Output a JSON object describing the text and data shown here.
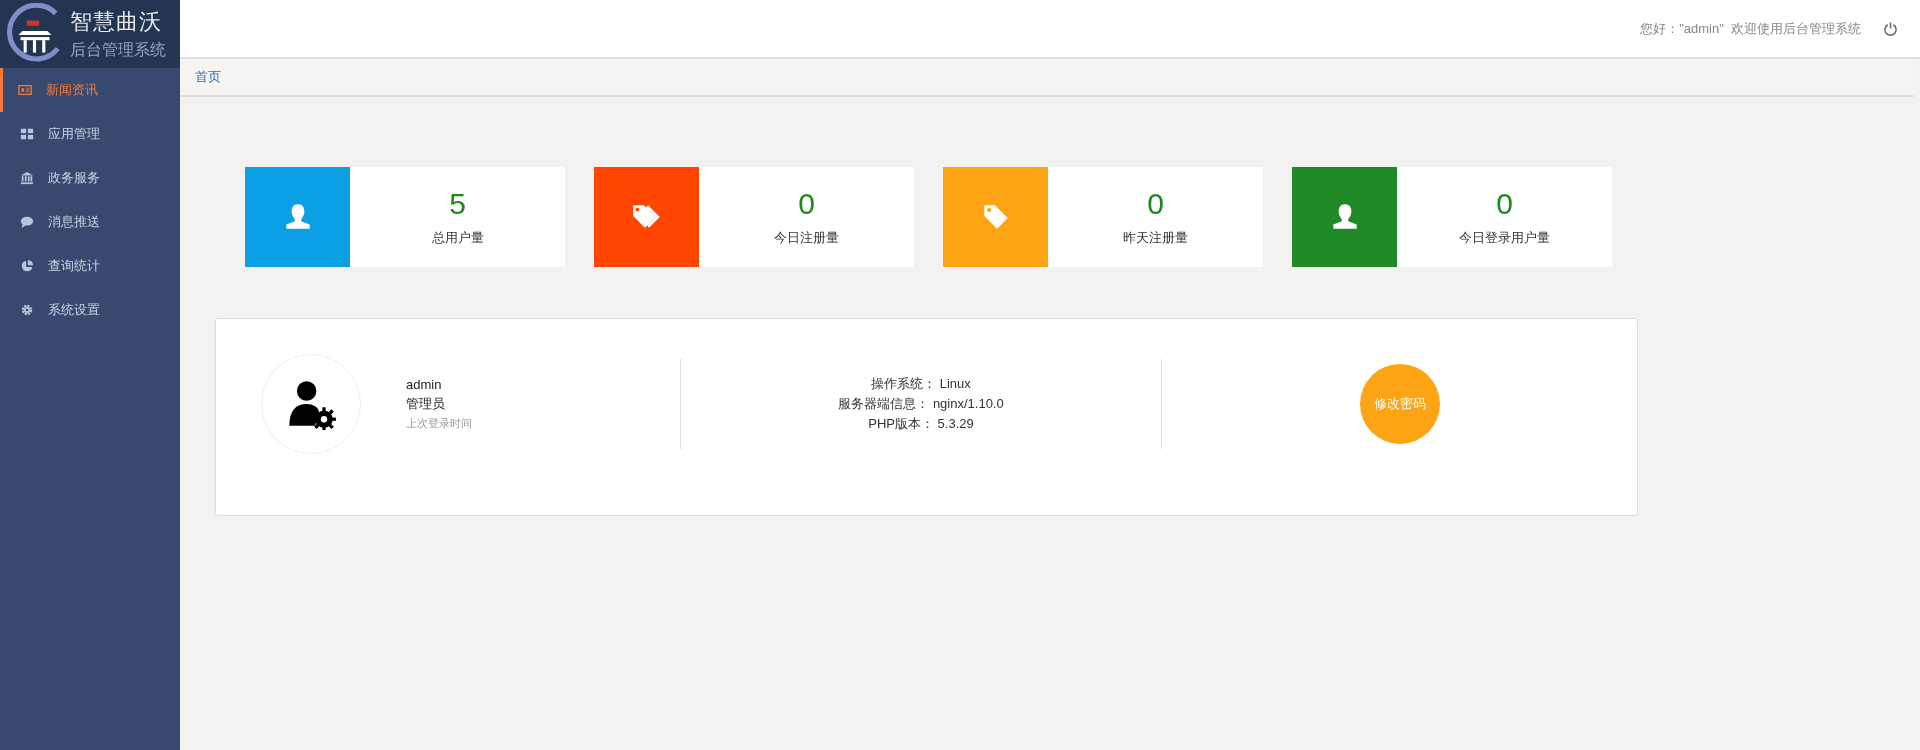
{
  "logo": {
    "title": "智慧曲沃",
    "subtitle": "后台管理系统"
  },
  "header": {
    "greeting": "您好：\"admin\"  欢迎使用后台管理系统"
  },
  "sidebar": {
    "items": [
      {
        "label": "新闻资讯",
        "kind": "news",
        "selected": true
      },
      {
        "label": "应用管理",
        "kind": "grid",
        "selected": false
      },
      {
        "label": "政务服务",
        "kind": "bank",
        "selected": false
      },
      {
        "label": "消息推送",
        "kind": "chat",
        "selected": false
      },
      {
        "label": "查询统计",
        "kind": "pie",
        "selected": false
      },
      {
        "label": "系统设置",
        "kind": "gear",
        "selected": false
      }
    ]
  },
  "breadcrumb": [
    "首页"
  ],
  "stats": [
    {
      "value": "5",
      "label": "总用户量",
      "kind": "user",
      "color": "#0ba0e6"
    },
    {
      "value": "0",
      "label": "今日注册量",
      "kind": "tags",
      "color": "#ff4500"
    },
    {
      "value": "0",
      "label": "昨天注册量",
      "kind": "tag",
      "color": "#fda414"
    },
    {
      "value": "0",
      "label": "今日登录用户量",
      "kind": "user",
      "color": "#208a27"
    }
  ],
  "profile": {
    "name": "admin",
    "role": "管理员",
    "last_login": "上次登录时间"
  },
  "server": [
    "操作系统： Linux",
    "服务器端信息： nginx/1.10.0",
    "PHP版本： 5.3.29"
  ],
  "change_password": "修改密码"
}
